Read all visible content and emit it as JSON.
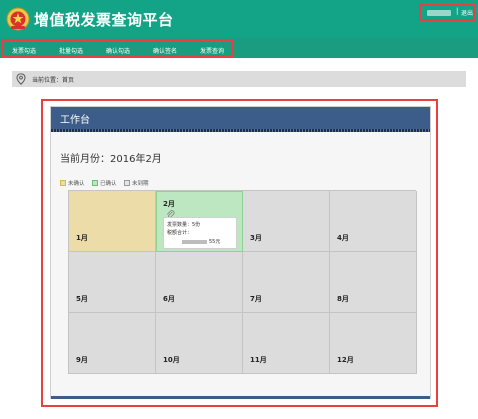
{
  "app": {
    "title": "增值税发票查询平台"
  },
  "user": {
    "separator": "|",
    "logout_label": "退出"
  },
  "nav": {
    "items": [
      "发票勾选",
      "批量勾选",
      "确认勾选",
      "确认签名",
      "发票查询"
    ]
  },
  "breadcrumb": {
    "text": "当前位置：首页"
  },
  "workbench": {
    "title": "工作台",
    "current_month_label": "当前月份：2016年2月",
    "legend": [
      {
        "label": "未确认",
        "color": "#ecdca8",
        "border": "#d6b94e"
      },
      {
        "label": "已确认",
        "color": "#bde7c0",
        "border": "#6cbf72"
      },
      {
        "label": "未到期",
        "color": "#e6e6e6",
        "border": "#9a9a9a"
      }
    ],
    "months": [
      {
        "label": "1月",
        "status": "unconfirmed"
      },
      {
        "label": "2月",
        "status": "confirmed",
        "invoice_count_label": "发票数量：5份",
        "tax_total_label": "税额合计：",
        "tax_total_suffix": "55元"
      },
      {
        "label": "3月",
        "status": "not_due"
      },
      {
        "label": "4月",
        "status": "not_due"
      },
      {
        "label": "5月",
        "status": "not_due"
      },
      {
        "label": "6月",
        "status": "not_due"
      },
      {
        "label": "7月",
        "status": "not_due"
      },
      {
        "label": "8月",
        "status": "not_due"
      },
      {
        "label": "9月",
        "status": "not_due"
      },
      {
        "label": "10月",
        "status": "not_due"
      },
      {
        "label": "11月",
        "status": "not_due"
      },
      {
        "label": "12月",
        "status": "not_due"
      }
    ]
  },
  "colors": {
    "header": "#13a488",
    "nav": "#1a9c80",
    "workbench_header": "#3c5d8a",
    "highlight_border": "#e74040"
  }
}
